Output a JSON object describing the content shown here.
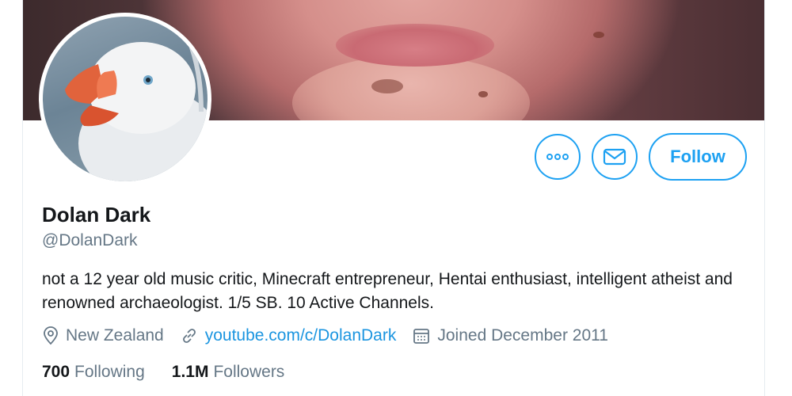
{
  "profile": {
    "display_name": "Dolan Dark",
    "handle": "@DolanDark",
    "bio": "not a 12 year old music critic, Minecraft entrepreneur, Hentai enthusiast, intelligent atheist and renowned archaeologist. 1/5 SB. 10 Active Channels.",
    "location": "New Zealand",
    "website": "youtube.com/c/DolanDark",
    "joined": "Joined December 2011"
  },
  "actions": {
    "follow_label": "Follow",
    "more_icon": "more-dots-icon",
    "message_icon": "envelope-icon"
  },
  "stats": {
    "following_count": "700",
    "following_label": "Following",
    "followers_count": "1.1M",
    "followers_label": "Followers"
  },
  "colors": {
    "accent": "#1da1f2",
    "link": "#1b95e0",
    "text_primary": "#14171a",
    "text_secondary": "#657786"
  },
  "icons": {
    "location": "location-pin-icon",
    "website": "link-icon",
    "joined": "calendar-icon"
  }
}
